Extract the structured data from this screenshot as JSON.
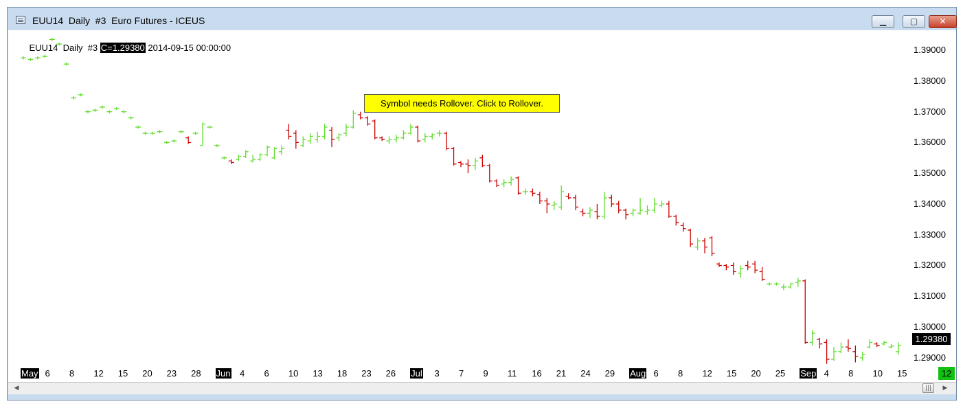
{
  "window": {
    "title": "EUU14  Daily  #3  Euro Futures - ICEUS",
    "buttons": {
      "minimize": "▁",
      "maximize": "▢",
      "close": "✕"
    }
  },
  "legend": {
    "symbol": "EUU14  Daily  #3 ",
    "close_value": "C=1.29380",
    "datetime": " 2014-09-15 00:00:00"
  },
  "rollover_message": "Symbol needs Rollover. Click to Rollover.",
  "price_axis": {
    "labels": [
      "1.39000",
      "1.38000",
      "1.37000",
      "1.36000",
      "1.35000",
      "1.34000",
      "1.33000",
      "1.32000",
      "1.31000",
      "1.30000",
      "1.29000"
    ],
    "last_price": "1.29380"
  },
  "date_axis": {
    "labels": [
      {
        "text": "May",
        "month": true
      },
      {
        "text": "6"
      },
      {
        "text": "8"
      },
      {
        "text": "12"
      },
      {
        "text": "15"
      },
      {
        "text": "20"
      },
      {
        "text": "23"
      },
      {
        "text": "28"
      },
      {
        "text": "Jun",
        "month": true
      },
      {
        "text": "4"
      },
      {
        "text": "6"
      },
      {
        "text": "10"
      },
      {
        "text": "13"
      },
      {
        "text": "18"
      },
      {
        "text": "23"
      },
      {
        "text": "26"
      },
      {
        "text": "Jul",
        "month": true
      },
      {
        "text": "3"
      },
      {
        "text": "7"
      },
      {
        "text": "9"
      },
      {
        "text": "11"
      },
      {
        "text": "16"
      },
      {
        "text": "21"
      },
      {
        "text": "24"
      },
      {
        "text": "29"
      },
      {
        "text": "Aug",
        "month": true
      },
      {
        "text": "6"
      },
      {
        "text": "8"
      },
      {
        "text": "12"
      },
      {
        "text": "15"
      },
      {
        "text": "20"
      },
      {
        "text": "25"
      },
      {
        "text": "Sep",
        "month": true
      },
      {
        "text": "4"
      },
      {
        "text": "8"
      },
      {
        "text": "10"
      },
      {
        "text": "15"
      }
    ],
    "bar_count": "12"
  },
  "colors": {
    "up_bar": "#5fdc2a",
    "down_bar": "#cc0000",
    "rollover_bg": "#ffff00",
    "count_box": "#11c211"
  },
  "chart_data": {
    "type": "ohlc",
    "ylim": [
      1.2875,
      1.3965
    ],
    "ticks": [
      1.39,
      1.38,
      1.37,
      1.36,
      1.35,
      1.34,
      1.33,
      1.32,
      1.31,
      1.3,
      1.29
    ],
    "bars": [
      [
        1.3875,
        1.388,
        1.387,
        1.3875
      ],
      [
        1.387,
        1.3875,
        1.3865,
        1.387
      ],
      [
        1.3875,
        1.388,
        1.387,
        1.3875
      ],
      [
        1.388,
        1.3885,
        1.3875,
        1.388
      ],
      [
        1.3935,
        1.394,
        1.393,
        1.3935
      ],
      [
        1.392,
        1.3925,
        1.3915,
        1.392
      ],
      [
        1.3855,
        1.386,
        1.385,
        1.3855
      ],
      [
        1.3745,
        1.375,
        1.374,
        1.3745
      ],
      [
        1.3755,
        1.376,
        1.375,
        1.3755
      ],
      [
        1.37,
        1.3705,
        1.3695,
        1.37
      ],
      [
        1.3705,
        1.371,
        1.37,
        1.3705
      ],
      [
        1.3715,
        1.372,
        1.371,
        1.3715
      ],
      [
        1.37,
        1.3705,
        1.3695,
        1.37
      ],
      [
        1.371,
        1.3715,
        1.3705,
        1.371
      ],
      [
        1.37,
        1.3705,
        1.3695,
        1.37
      ],
      [
        1.368,
        1.3685,
        1.3675,
        1.368
      ],
      [
        1.365,
        1.3655,
        1.3645,
        1.365
      ],
      [
        1.363,
        1.3635,
        1.3625,
        1.363
      ],
      [
        1.363,
        1.3635,
        1.3625,
        1.363
      ],
      [
        1.3635,
        1.364,
        1.363,
        1.3635
      ],
      [
        1.36,
        1.3605,
        1.3595,
        1.36
      ],
      [
        1.3605,
        1.361,
        1.36,
        1.3605
      ],
      [
        1.3635,
        1.364,
        1.363,
        1.3635
      ],
      [
        1.3615,
        1.362,
        1.3595,
        1.36
      ],
      [
        1.363,
        1.3635,
        1.3625,
        1.363
      ],
      [
        1.359,
        1.3665,
        1.359,
        1.366
      ],
      [
        1.365,
        1.3655,
        1.3645,
        1.365
      ],
      [
        1.359,
        1.3595,
        1.3585,
        1.359
      ],
      [
        1.355,
        1.3555,
        1.3545,
        1.355
      ],
      [
        1.354,
        1.3545,
        1.353,
        1.3535
      ],
      [
        1.3545,
        1.356,
        1.354,
        1.3555
      ],
      [
        1.3555,
        1.3575,
        1.355,
        1.357
      ],
      [
        1.354,
        1.356,
        1.3535,
        1.3545
      ],
      [
        1.3545,
        1.3565,
        1.354,
        1.356
      ],
      [
        1.356,
        1.359,
        1.3555,
        1.3585
      ],
      [
        1.355,
        1.3585,
        1.3545,
        1.358
      ],
      [
        1.357,
        1.359,
        1.356,
        1.358
      ],
      [
        1.364,
        1.366,
        1.361,
        1.362
      ],
      [
        1.363,
        1.364,
        1.358,
        1.36
      ],
      [
        1.359,
        1.362,
        1.3585,
        1.361
      ],
      [
        1.3605,
        1.363,
        1.3595,
        1.362
      ],
      [
        1.361,
        1.3635,
        1.36,
        1.362
      ],
      [
        1.362,
        1.366,
        1.361,
        1.365
      ],
      [
        1.364,
        1.365,
        1.3585,
        1.361
      ],
      [
        1.3615,
        1.363,
        1.3605,
        1.3625
      ],
      [
        1.363,
        1.366,
        1.362,
        1.365
      ],
      [
        1.365,
        1.3705,
        1.3645,
        1.3695
      ],
      [
        1.369,
        1.37,
        1.3675,
        1.368
      ],
      [
        1.368,
        1.3685,
        1.3655,
        1.366
      ],
      [
        1.367,
        1.3675,
        1.361,
        1.3615
      ],
      [
        1.3615,
        1.362,
        1.3605,
        1.361
      ],
      [
        1.3605,
        1.362,
        1.3595,
        1.361
      ],
      [
        1.361,
        1.3625,
        1.36,
        1.3615
      ],
      [
        1.3615,
        1.364,
        1.361,
        1.363
      ],
      [
        1.363,
        1.366,
        1.3625,
        1.365
      ],
      [
        1.365,
        1.3655,
        1.36,
        1.3605
      ],
      [
        1.361,
        1.363,
        1.36,
        1.362
      ],
      [
        1.362,
        1.363,
        1.361,
        1.3625
      ],
      [
        1.363,
        1.364,
        1.362,
        1.363
      ],
      [
        1.363,
        1.3635,
        1.3575,
        1.358
      ],
      [
        1.358,
        1.3585,
        1.3525,
        1.353
      ],
      [
        1.3535,
        1.354,
        1.352,
        1.353
      ],
      [
        1.353,
        1.3545,
        1.35,
        1.3525
      ],
      [
        1.3525,
        1.355,
        1.351,
        1.354
      ],
      [
        1.355,
        1.356,
        1.352,
        1.3525
      ],
      [
        1.3525,
        1.353,
        1.347,
        1.3475
      ],
      [
        1.3475,
        1.348,
        1.3455,
        1.346
      ],
      [
        1.3465,
        1.348,
        1.3455,
        1.347
      ],
      [
        1.347,
        1.349,
        1.346,
        1.348
      ],
      [
        1.3485,
        1.349,
        1.343,
        1.3435
      ],
      [
        1.344,
        1.345,
        1.343,
        1.344
      ],
      [
        1.344,
        1.345,
        1.3425,
        1.3435
      ],
      [
        1.343,
        1.344,
        1.34,
        1.341
      ],
      [
        1.341,
        1.342,
        1.337,
        1.34
      ],
      [
        1.3395,
        1.341,
        1.338,
        1.34
      ],
      [
        1.339,
        1.346,
        1.338,
        1.344
      ],
      [
        1.3425,
        1.3435,
        1.3415,
        1.342
      ],
      [
        1.342,
        1.343,
        1.338,
        1.339
      ],
      [
        1.3375,
        1.3385,
        1.336,
        1.337
      ],
      [
        1.337,
        1.339,
        1.3355,
        1.338
      ],
      [
        1.3375,
        1.34,
        1.335,
        1.336
      ],
      [
        1.336,
        1.344,
        1.335,
        1.342
      ],
      [
        1.342,
        1.343,
        1.339,
        1.34
      ],
      [
        1.34,
        1.341,
        1.337,
        1.338
      ],
      [
        1.338,
        1.3385,
        1.335,
        1.3365
      ],
      [
        1.337,
        1.3385,
        1.336,
        1.338
      ],
      [
        1.337,
        1.342,
        1.3365,
        1.338
      ],
      [
        1.3375,
        1.3395,
        1.3365,
        1.338
      ],
      [
        1.338,
        1.342,
        1.337,
        1.34
      ],
      [
        1.3395,
        1.341,
        1.339,
        1.34
      ],
      [
        1.34,
        1.341,
        1.3355,
        1.336
      ],
      [
        1.336,
        1.3365,
        1.333,
        1.334
      ],
      [
        1.333,
        1.334,
        1.331,
        1.332
      ],
      [
        1.3315,
        1.332,
        1.326,
        1.327
      ],
      [
        1.326,
        1.329,
        1.325,
        1.328
      ],
      [
        1.328,
        1.329,
        1.324,
        1.326
      ],
      [
        1.329,
        1.3295,
        1.323,
        1.324
      ],
      [
        1.3205,
        1.321,
        1.3195,
        1.32
      ],
      [
        1.32,
        1.3205,
        1.3185,
        1.3195
      ],
      [
        1.32,
        1.321,
        1.317,
        1.318
      ],
      [
        1.3175,
        1.32,
        1.316,
        1.319
      ],
      [
        1.32,
        1.3215,
        1.3185,
        1.3195
      ],
      [
        1.3205,
        1.3215,
        1.3175,
        1.3185
      ],
      [
        1.318,
        1.3195,
        1.315,
        1.3155
      ],
      [
        1.314,
        1.3145,
        1.3135,
        1.314
      ],
      [
        1.314,
        1.3145,
        1.3135,
        1.314
      ],
      [
        1.313,
        1.314,
        1.312,
        1.313
      ],
      [
        1.313,
        1.3145,
        1.3125,
        1.314
      ],
      [
        1.3145,
        1.316,
        1.313,
        1.315
      ],
      [
        1.315,
        1.3155,
        1.2945,
        1.295
      ],
      [
        1.295,
        1.299,
        1.294,
        1.298
      ],
      [
        1.296,
        1.2965,
        1.293,
        1.2945
      ],
      [
        1.295,
        1.296,
        1.288,
        1.2895
      ],
      [
        1.2895,
        1.2935,
        1.289,
        1.292
      ],
      [
        1.292,
        1.295,
        1.2915,
        1.2935
      ],
      [
        1.2935,
        1.296,
        1.292,
        1.293
      ],
      [
        1.292,
        1.294,
        1.2885,
        1.2905
      ],
      [
        1.29,
        1.292,
        1.289,
        1.291
      ],
      [
        1.2935,
        1.296,
        1.293,
        1.295
      ],
      [
        1.2945,
        1.295,
        1.2935,
        1.294
      ],
      [
        1.2945,
        1.2955,
        1.294,
        1.295
      ],
      [
        1.2935,
        1.2945,
        1.293,
        1.2938
      ],
      [
        1.292,
        1.295,
        1.291,
        1.294
      ]
    ]
  }
}
